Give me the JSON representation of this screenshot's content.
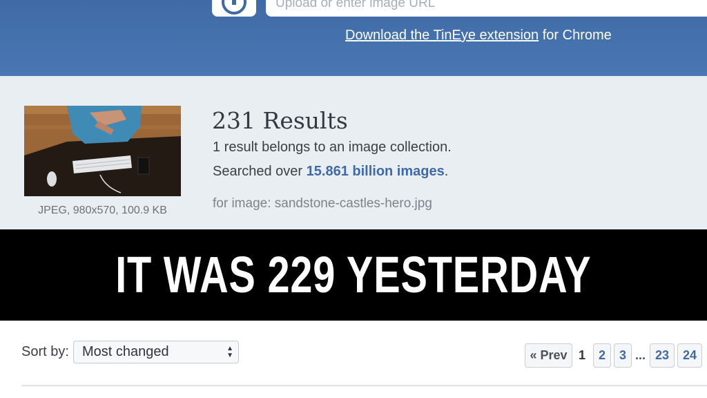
{
  "header": {
    "upload_icon": "upload-icon",
    "url_placeholder": "Upload or enter image URL",
    "extension_link": "Download the TinEye extension",
    "extension_suffix": " for Chrome"
  },
  "results": {
    "count": "231 Results",
    "collection_text": "1 result belongs to an image collection.",
    "searched_prefix": "Searched over ",
    "searched_count": "15.861 billion images",
    "searched_suffix": ".",
    "for_image": "for image: sandstone-castles-hero.jpg",
    "thumbnail_caption": "JPEG, 980x570, 100.9 KB"
  },
  "banner": {
    "text": "It was 229 yesterday"
  },
  "sort": {
    "label": "Sort by:",
    "selected": "Most changed"
  },
  "pagination": {
    "prev": "« Prev",
    "current": "1",
    "pages": [
      "2",
      "3"
    ],
    "ellipsis": "...",
    "later_pages": [
      "23",
      "24"
    ]
  },
  "colors": {
    "header_blue": "#4a77b3",
    "link_blue": "#3f6aa6",
    "results_bg": "#e9eef3",
    "banner_bg": "#000000"
  }
}
